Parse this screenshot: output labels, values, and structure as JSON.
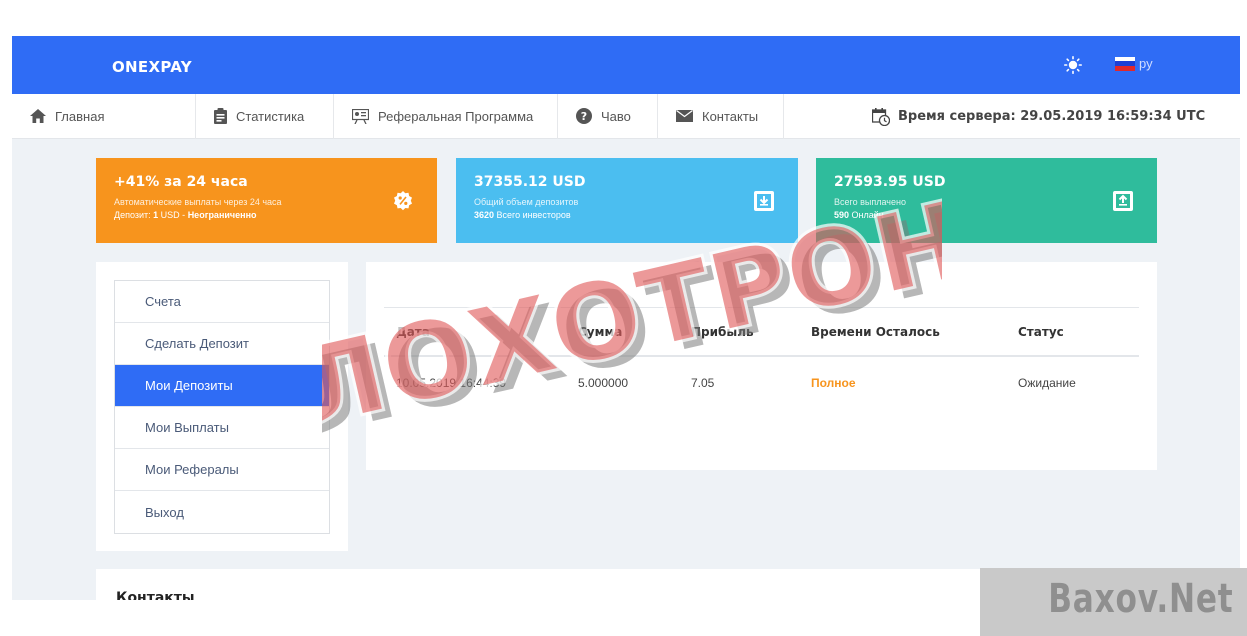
{
  "header": {
    "logo_prefix": "ONE",
    "logo_mark": "X",
    "logo_suffix": "PAY",
    "theme_icon": "sun-icon",
    "language": "ру",
    "flag_colors": [
      "#ffffff",
      "#1c3fd6",
      "#e0282b"
    ]
  },
  "nav": {
    "items": [
      {
        "label": "Главная",
        "icon": "home-icon"
      },
      {
        "label": "Статистика",
        "icon": "clipboard-icon"
      },
      {
        "label": "Реферальная Программа",
        "icon": "referral-icon"
      },
      {
        "label": "Чаво",
        "icon": "question-icon"
      },
      {
        "label": "Контакты",
        "icon": "envelope-icon"
      }
    ],
    "server_time_label": "Время сервера: 29.05.2019 16:59:34 UTC"
  },
  "cards": [
    {
      "title": "+41% за 24 часа",
      "line1": "Автоматические выплаты через 24 часа",
      "line2_prefix": "Депозит: ",
      "line2_value": "1",
      "line2_mid": " USD - ",
      "line2_strong": "Неограниченно",
      "icon": "percent-badge-icon",
      "color": "#f7941d"
    },
    {
      "title": "37355.12 USD",
      "line1": "Общий объем депозитов",
      "line2_value": "3620",
      "line2_suffix": " Всего инвесторов",
      "icon": "download-box-icon",
      "color": "#4bbef0"
    },
    {
      "title": "27593.95 USD",
      "line1": "Всего выплачено",
      "line2_value": "590",
      "line2_suffix": " Онлайн",
      "icon": "upload-box-icon",
      "color": "#2fbc9c"
    }
  ],
  "sidebar": {
    "items": [
      {
        "label": "Счета"
      },
      {
        "label": "Сделать Депозит"
      },
      {
        "label": "Мои Депозиты",
        "active": true
      },
      {
        "label": "Мои Выплаты"
      },
      {
        "label": "Мои Рефералы"
      },
      {
        "label": "Выход"
      }
    ]
  },
  "table": {
    "headers": [
      "Дата",
      "Сумма",
      "Прибыль",
      "Времени Осталось",
      "Статус"
    ],
    "rows": [
      [
        "10.05.2019 16:44:39",
        "5.000000",
        "7.05",
        "Полное",
        "Ожидание"
      ]
    ]
  },
  "contacts": {
    "title": "Контакты"
  },
  "watermarks": {
    "stamp_text": "ЛОХОТРОН",
    "stamp_color": "#e15a5a",
    "site_text": "Baxov.Net"
  }
}
